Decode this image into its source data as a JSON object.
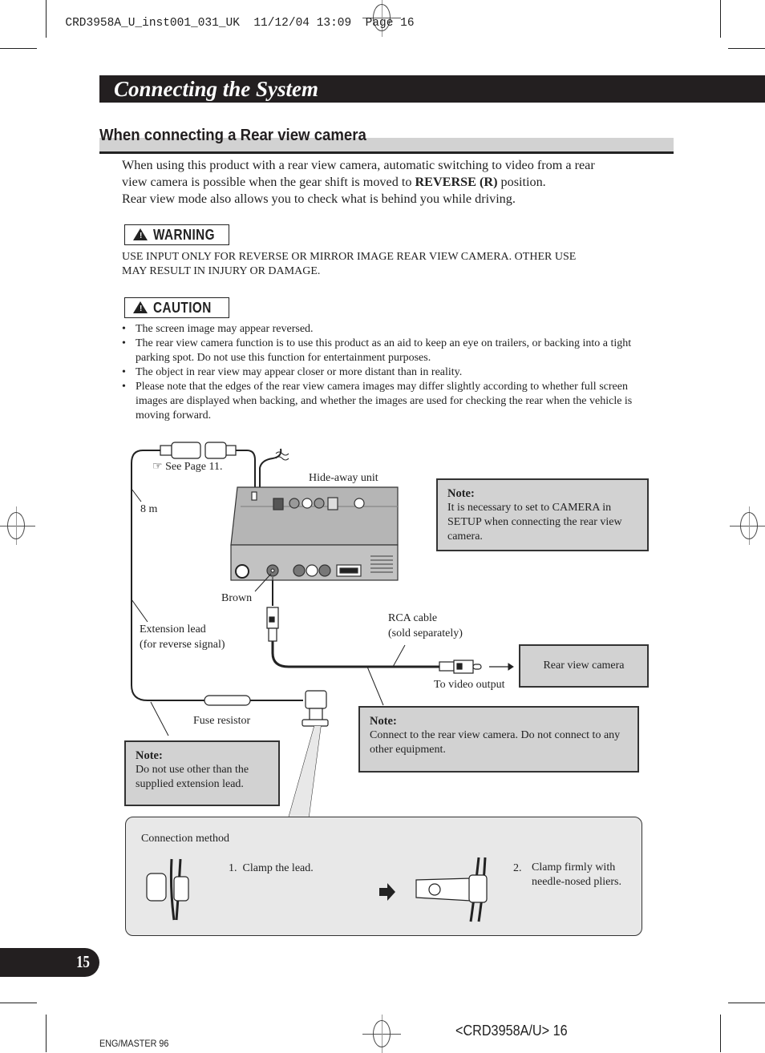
{
  "print_header": {
    "filename": "CRD3958A_U_inst001_031_UK",
    "date": "11/12/04",
    "time": "13:09",
    "page_label": "Page 16"
  },
  "chapter_title": "Connecting the System",
  "section_title": "When connecting a Rear view camera",
  "intro": {
    "line1": "When using this product with a rear view camera, automatic switching to video from a rear",
    "line2_pre": "view camera is possible when the gear shift is moved to ",
    "line2_bold": "REVERSE (R)",
    "line2_post": " position.",
    "line3": "Rear view mode also allows you to check what is behind you while driving."
  },
  "warning": {
    "label": "WARNING",
    "icon": "warning-triangle-icon",
    "text_line1": "USE INPUT ONLY FOR REVERSE OR MIRROR IMAGE REAR VIEW CAMERA. OTHER USE",
    "text_line2": "MAY RESULT IN INJURY OR DAMAGE."
  },
  "caution": {
    "label": "CAUTION",
    "icon": "warning-triangle-icon",
    "bullets": [
      "The screen image may appear reversed.",
      "The rear view camera function is to use this product as an aid to keep an eye on trailers, or backing into a tight parking spot. Do not use this function for entertainment purposes.",
      "The object in rear view may appear closer or more distant than in reality.",
      "Please note that the edges of the rear view camera images may differ slightly according to whether full screen images are displayed when backing, and whether the images are used for checking the rear when the vehicle is moving forward."
    ]
  },
  "diagram": {
    "see_page": "See Page 11.",
    "see_page_icon": "pointing-hand-icon",
    "hide_away_unit": "Hide-away unit",
    "length": "8 m",
    "brown": "Brown",
    "extension_lead_1": "Extension lead",
    "extension_lead_2": "(for reverse signal)",
    "rca_cable_1": "RCA cable",
    "rca_cable_2": "(sold separately)",
    "to_video_output": "To video output",
    "rear_view_camera": "Rear view camera",
    "fuse_resistor": "Fuse resistor",
    "notes": [
      {
        "title": "Note:",
        "text": "It is necessary to set to CAMERA in SETUP when connecting the rear view camera."
      },
      {
        "title": "Note:",
        "text": "Connect to the rear view camera. Do not connect to any other equipment."
      },
      {
        "title": "Note:",
        "text": "Do not use other than the supplied extension lead."
      }
    ],
    "connection_method": {
      "title": "Connection method",
      "step1": "1.  Clamp the lead.",
      "step2_num": "2.",
      "step2_text": "Clamp firmly with needle-nosed pliers."
    }
  },
  "footer": {
    "page_number": "15",
    "master": "ENG/MASTER 96",
    "doc_code": "<CRD3958A/U> 16"
  }
}
